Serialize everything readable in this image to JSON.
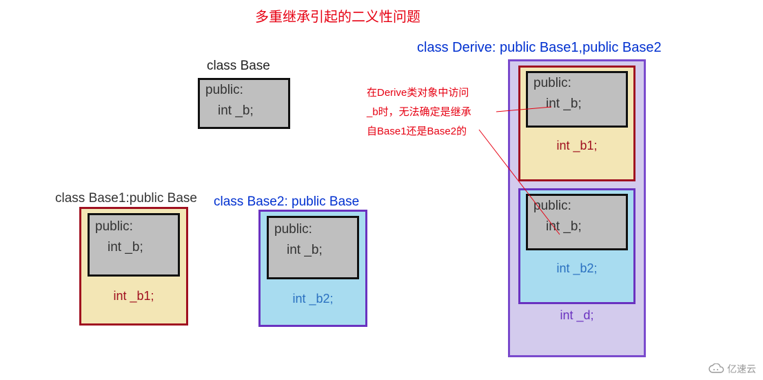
{
  "title": "多重继承引起的二义性问题",
  "labels": {
    "base": "class Base",
    "base1": "class Base1:public Base",
    "base2": "class Base2: public Base",
    "derive": "class Derive: public Base1,public Base2"
  },
  "base": {
    "access": "public:",
    "member": "int _b;"
  },
  "base1": {
    "inner_access": "public:",
    "inner_member": "int _b;",
    "own_member": "int _b1;"
  },
  "base2": {
    "inner_access": "public:",
    "inner_member": "int _b;",
    "own_member": "int _b2;"
  },
  "derive": {
    "base1_part": {
      "inner_access": "public:",
      "inner_member": "int _b;",
      "own_member": "int _b1;"
    },
    "base2_part": {
      "inner_access": "public:",
      "inner_member": "int _b;",
      "own_member": "int _b2;"
    },
    "own_member": "int _d;"
  },
  "annotation": {
    "line1": "在Derive类对象中访问",
    "line2": "_b时，无法确定是继承",
    "line3": "自Base1还是Base2的"
  },
  "watermark": "亿速云"
}
